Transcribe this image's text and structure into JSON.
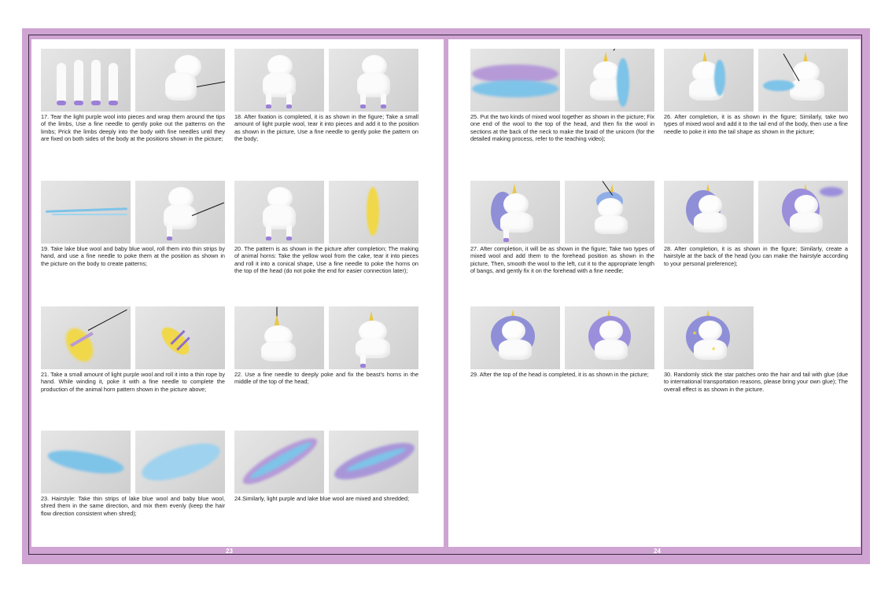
{
  "pages": {
    "left_number": "23",
    "right_number": "24"
  },
  "steps": {
    "s17": "17. Tear the light purple wool into pieces and wrap them around the tips of the limbs, Use a fine needle to gently poke out the patterns on the limbs; Prick the limbs deeply into the body with fine needles until they are fixed on both sides of the body at the positions shown in the picture;",
    "s18": "18. After fixation is completed, it is as shown in the figure; Take a small amount of light purple wool, tear it into pieces and add it to the position as shown in the picture, Use a fine needle to gently poke the pattern on the body;",
    "s19": "19. Take lake blue wool and baby blue wool, roll them into thin strips by hand, and use a fine needle to poke them at the position as shown in the picture on the body to create patterns;",
    "s20": "20. The pattern is as shown in the picture after completion; The making of animal horns: Take the yellow wool from the cake, tear it into pieces and roll it into a conical shape, Use a fine needle to poke the horns on the top of the head (do not poke the end for easier connection later);",
    "s21": "21. Take a small amount of light purple wool and roll it into a thin rope by hand. While winding it, poke it with a fine needle to complete the production of the animal horn pattern shown in the picture above;",
    "s22": "22. Use a fine needle to deeply poke and fix the beast's horns in the middle of the top of the head;",
    "s23": "23. Hairstyle: Take thin strips of lake blue wool and baby blue wool, shred them in the same direction, and mix them evenly (keep the hair flow direction consistent when shred);",
    "s24": "24.Similarly, light purple and lake blue wool are mixed and shredded;",
    "s25": "25. Put the two kinds of mixed wool together as shown in the picture; Fix one end of the wool to the top of the head, and then fix the wool in sections at the back of the neck to make the braid of the unicorn (for the detailed making process, refer to the teaching video);",
    "s26": "26. After completion, it is as shown in the figure; Similarly, take two types of mixed wool and add it to the tail end of the body, then use a fine needle to poke it into the tail shape as shown in the picture;",
    "s27": "27. After completion, it will be as shown in the figure; Take two types of mixed wool and add them to the forehead position as shown in the picture, Then, smooth the wool to the left, cut it to the appropriate length of bangs, and gently fix it on the forehead with a fine needle;",
    "s28": "28. After completion, it is as shown in the figure; Similarly, create a hairstyle at the back of the head (you can make the hairstyle according to your personal preference);",
    "s29": "29. After the top of the head is completed, it is as shown in the picture;",
    "s30": "30. Randomly stick the star patches onto the hair and tail with glue (due to international transportation reasons, please bring your own glue); The overall effect is as shown in the picture."
  },
  "colors": {
    "frame": "#cfa4d3",
    "hoof_purple": "#9b7fd8",
    "wool_blue": "#7ec3e8",
    "wool_purple": "#b69ad8",
    "wool_yellow": "#f0d84a"
  }
}
